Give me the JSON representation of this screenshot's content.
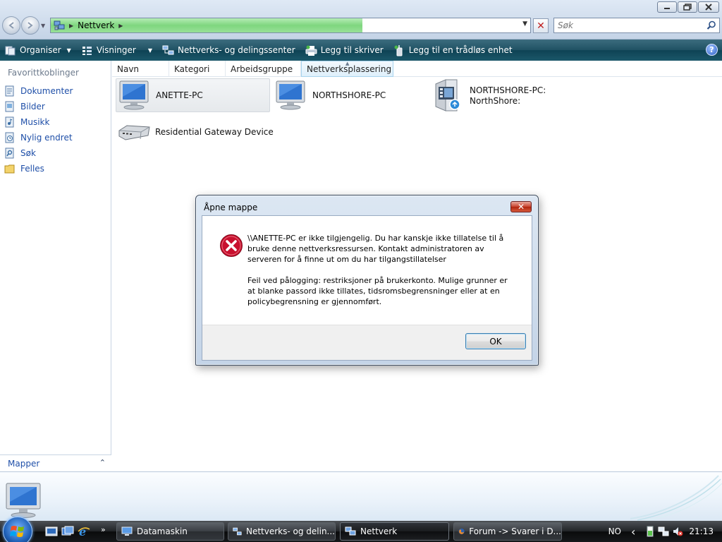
{
  "window": {
    "controls": [
      "minimize-icon",
      "maximize-icon",
      "close-icon"
    ]
  },
  "address_bar": {
    "path": "Nettverk",
    "loading_fraction": 0.65,
    "stop_symbol": "✕"
  },
  "search": {
    "placeholder": "Søk"
  },
  "command_bar": {
    "organize": "Organiser",
    "views": "Visninger",
    "network_center": "Nettverks- og delingssenter",
    "add_printer": "Legg til skriver",
    "add_wireless": "Legg til en trådløs enhet",
    "help_symbol": "?"
  },
  "nav_pane": {
    "favorites_header": "Favorittkoblinger",
    "favorites": [
      {
        "label": "Dokumenter",
        "icon": "documents-icon"
      },
      {
        "label": "Bilder",
        "icon": "pictures-icon"
      },
      {
        "label": "Musikk",
        "icon": "music-icon"
      },
      {
        "label": "Nylig endret",
        "icon": "recent-icon"
      },
      {
        "label": "Søk",
        "icon": "search-folder-icon"
      },
      {
        "label": "Felles",
        "icon": "public-folder-icon"
      }
    ],
    "folders_label": "Mapper"
  },
  "columns": [
    "Navn",
    "Kategori",
    "Arbeidsgruppe",
    "Nettverksplassering"
  ],
  "items": [
    {
      "label": "ANETTE-PC",
      "icon": "computer-icon",
      "selected": true
    },
    {
      "label": "NORTHSHORE-PC",
      "icon": "computer-icon",
      "selected": false
    },
    {
      "label_line1": "NORTHSHORE-PC:",
      "label_line2": "NorthShore:",
      "icon": "media-device-icon",
      "selected": false
    },
    {
      "label": "Residential Gateway Device",
      "icon": "router-icon",
      "selected": false
    }
  ],
  "dialog": {
    "title": "Åpne mappe",
    "message1": "\\\\ANETTE-PC er ikke tilgjengelig. Du har kanskje ikke tillatelse til å bruke denne nettverksressursen. Kontakt administratoren av serveren for å finne ut om du har tilgangstillatelser",
    "message2": "Feil ved pålogging: restriksjoner på brukerkonto. Mulige grunner er at blanke passord ikke tillates, tidsromsbegrensninger eller at en policybegrensning er gjennomført.",
    "ok": "OK",
    "close_symbol": "✕"
  },
  "taskbar": {
    "quick_launch": [
      "show-desktop-icon",
      "switch-windows-icon",
      "internet-explorer-icon"
    ],
    "more_symbol": "»",
    "tasks": [
      {
        "label": "Datamaskin",
        "active": false
      },
      {
        "label": "Nettverks- og delin...",
        "active": false
      },
      {
        "label": "Nettverk",
        "active": true
      },
      {
        "label": "Forum -> Svarer i D...",
        "active": false
      }
    ],
    "language": "NO",
    "tray_chevron": "‹",
    "clock": "21:13"
  },
  "colors": {
    "command_bar": "#1b5769",
    "link": "#1f4fa8",
    "error_red": "#c8102e",
    "address_progress": "#7fd67f"
  }
}
